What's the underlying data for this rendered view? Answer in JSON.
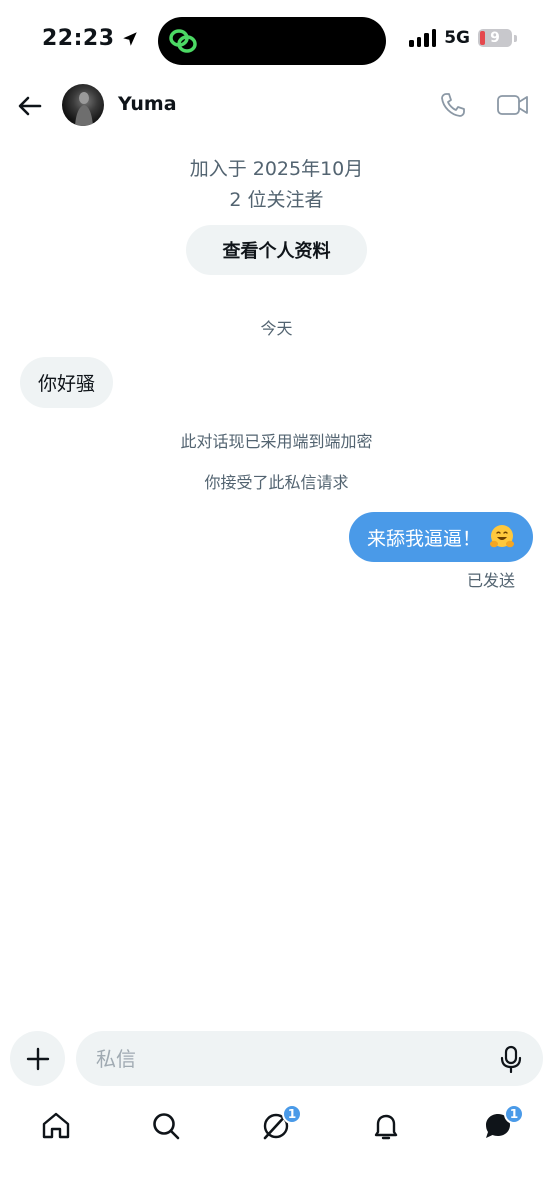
{
  "status_bar": {
    "time": "22:23",
    "network": "5G",
    "battery": "9"
  },
  "header": {
    "contact_name": "Yuma",
    "icons": [
      "back-arrow-icon",
      "avatar",
      "phone-icon",
      "video-icon"
    ]
  },
  "profile": {
    "joined": "加入于 2025年10月",
    "followers": "2 位关注者",
    "view_profile_label": "查看个人资料"
  },
  "conversation": {
    "day_label": "今天",
    "messages": [
      {
        "direction": "incoming",
        "text": "你好骚"
      },
      {
        "direction": "outgoing",
        "text": "来舔我逼逼！",
        "emoji": "hugging-face-emoji",
        "status": "已发送"
      }
    ],
    "system_notes": [
      "此对话现已采用端到端加密",
      "你接受了此私信请求"
    ]
  },
  "composer": {
    "placeholder": "私信"
  },
  "bottom_nav": {
    "items": [
      {
        "icon": "home-icon"
      },
      {
        "icon": "search-icon"
      },
      {
        "icon": "grok-icon",
        "badge": "1"
      },
      {
        "icon": "bell-icon"
      },
      {
        "icon": "messages-icon",
        "badge": "1"
      }
    ]
  },
  "colors": {
    "accent": "#4a9ae8",
    "bubble_in": "#eff3f4",
    "secondary_text": "#536471"
  }
}
